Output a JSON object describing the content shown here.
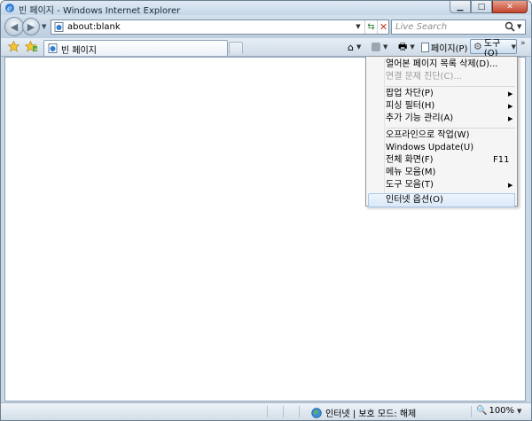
{
  "window": {
    "title": "빈 페이지 - Windows Internet Explorer"
  },
  "nav": {
    "address": "about:blank",
    "search_placeholder": "Live Search"
  },
  "tab": {
    "label": "빈 페이지"
  },
  "commands": {
    "page_label": "페이지(P)",
    "tools_label": "도구(O)"
  },
  "menu": {
    "items": [
      {
        "label": "열어본 페이지 목록 삭제(D)...",
        "disabled": false
      },
      {
        "label": "연결 문제 진단(C)...",
        "disabled": true
      },
      {
        "label": "팝업 차단(P)",
        "submenu": true
      },
      {
        "label": "피싱 필터(H)",
        "submenu": true
      },
      {
        "label": "추가 기능 관리(A)",
        "submenu": true
      },
      {
        "label": "오프라인으로 작업(W)"
      },
      {
        "label": "Windows Update(U)"
      },
      {
        "label": "전체 화면(F)",
        "shortcut": "F11"
      },
      {
        "label": "메뉴 모음(M)"
      },
      {
        "label": "도구 모음(T)",
        "submenu": true
      },
      {
        "label": "인터넷 옵션(O)",
        "highlighted": true
      }
    ]
  },
  "status": {
    "zone": "인터넷 | 보호 모드: 해제",
    "zoom": "100%"
  },
  "colors": {
    "frame": "#c9d8e6",
    "close": "#c4442c",
    "menu_bg": "#f5f5f5",
    "menu_highlight": "#d9e8f8"
  }
}
